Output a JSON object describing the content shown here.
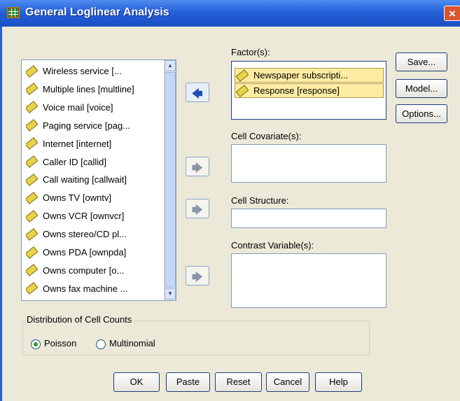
{
  "window": {
    "title": "General Loglinear Analysis",
    "close_icon": "×"
  },
  "variables": [
    "Wireless service [...",
    "Multiple lines [multline]",
    "Voice mail [voice]",
    "Paging service [pag...",
    "Internet [internet]",
    "Caller ID [callid]",
    "Call waiting [callwait]",
    "Owns TV [owntv]",
    "Owns VCR [ownvcr]",
    "Owns stereo/CD pl...",
    "Owns PDA [ownpda]",
    "Owns computer [o...",
    "Owns fax machine ..."
  ],
  "factors": {
    "label": "Factor(s):",
    "items": [
      "Newspaper subscripti...",
      "Response [response]"
    ]
  },
  "cell_covariates": {
    "label": "Cell Covariate(s):"
  },
  "cell_structure": {
    "label": "Cell Structure:"
  },
  "contrast_variables": {
    "label": "Contrast Variable(s):"
  },
  "side_buttons": {
    "save": "Save...",
    "model": "Model...",
    "options": "Options..."
  },
  "distribution": {
    "title": "Distribution of Cell Counts",
    "poisson": "Poisson",
    "multinomial": "Multinomial",
    "selected": "Poisson"
  },
  "bottom_buttons": {
    "ok": "OK",
    "paste": "Paste",
    "reset": "Reset",
    "cancel": "Cancel",
    "help": "Help"
  },
  "icons": {
    "arrow_left": "🡄",
    "arrow_right": "🡆",
    "scroll_up": "▲",
    "scroll_down": "▼"
  },
  "colors": {
    "titlebar": "#2460d8",
    "dialog_bg": "#ece9d8",
    "selection": "#fdeca4"
  }
}
